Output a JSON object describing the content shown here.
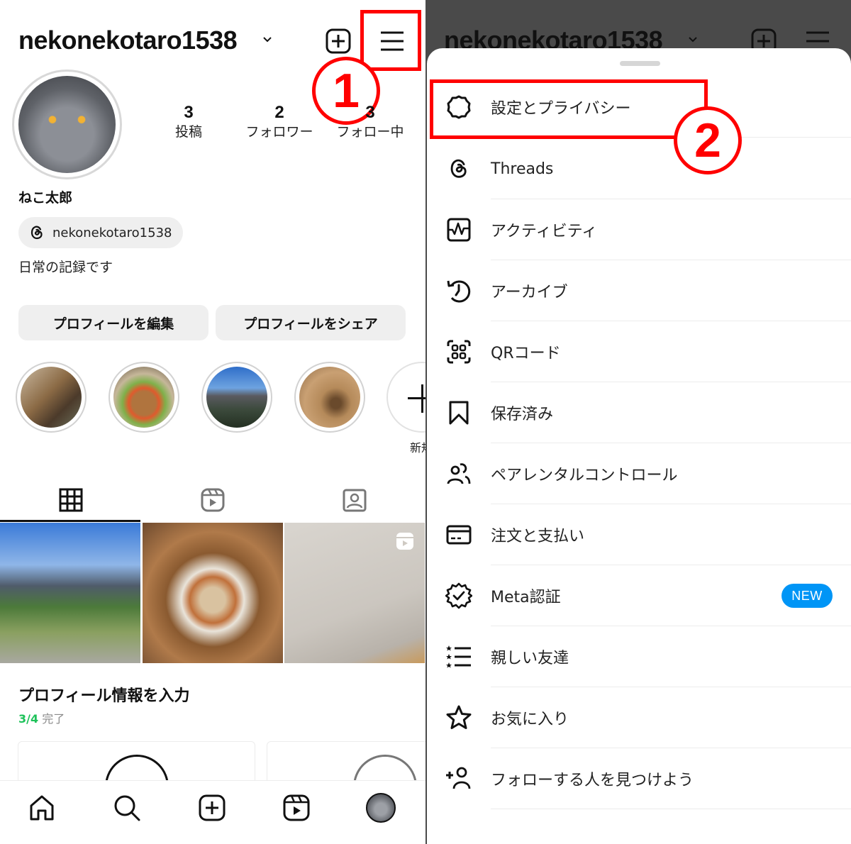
{
  "profile": {
    "username": "nekonekotaro1538",
    "display_name": "ねこ太郎",
    "threads_handle": "nekonekotaro1538",
    "bio": "日常の記録です",
    "stats": [
      {
        "value": "3",
        "label": "投稿"
      },
      {
        "value": "2",
        "label": "フォロワー"
      },
      {
        "value": "3",
        "label": "フォロー中"
      }
    ],
    "buttons": {
      "edit": "プロフィールを編集",
      "share": "プロフィールをシェア"
    },
    "highlights": [
      {
        "name": "highlight-cafe"
      },
      {
        "name": "highlight-noodles"
      },
      {
        "name": "highlight-mountain"
      },
      {
        "name": "highlight-dog"
      }
    ],
    "new_highlight_label": "新規",
    "tabs": [
      "grid",
      "reels",
      "tagged"
    ],
    "completion": {
      "title": "プロフィール情報を入力",
      "done": "3/4",
      "suffix": "完了"
    }
  },
  "annotations": {
    "step1": "1",
    "step2": "2",
    "color": "#ff0000"
  },
  "menu": {
    "items": [
      {
        "label": "設定とプライバシー",
        "icon": "settings-gear-icon"
      },
      {
        "label": "Threads",
        "icon": "threads-icon"
      },
      {
        "label": "アクティビティ",
        "icon": "activity-icon"
      },
      {
        "label": "アーカイブ",
        "icon": "archive-clock-icon"
      },
      {
        "label": "QRコード",
        "icon": "qr-code-icon"
      },
      {
        "label": "保存済み",
        "icon": "bookmark-icon"
      },
      {
        "label": "ペアレンタルコントロール",
        "icon": "parental-control-icon"
      },
      {
        "label": "注文と支払い",
        "icon": "credit-card-icon"
      },
      {
        "label": "Meta認証",
        "icon": "verified-badge-icon",
        "badge": "NEW"
      },
      {
        "label": "親しい友達",
        "icon": "close-friends-icon"
      },
      {
        "label": "お気に入り",
        "icon": "star-icon"
      },
      {
        "label": "フォローする人を見つけよう",
        "icon": "add-person-icon"
      }
    ]
  },
  "colors": {
    "accent_blue": "#0095f6",
    "progress_green": "#1ec25a",
    "annotation_red": "#ff0000"
  }
}
